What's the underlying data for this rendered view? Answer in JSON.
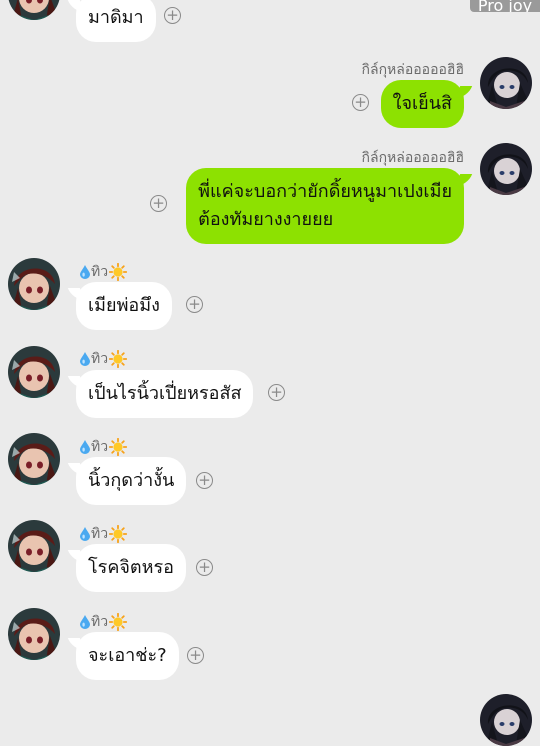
{
  "overlay": {
    "watermark": "Pro joy"
  },
  "plus_glyph": "+",
  "messages": [
    {
      "sender": "",
      "text": "มาดิมา",
      "side": "in"
    },
    {
      "sender": "กิล์กุหล่อออออฮิฮิ",
      "text": "ใจเย็นสิ",
      "side": "out"
    },
    {
      "sender": "กิล์กุหล่อออออฮิฮิ",
      "text_line1": "พี่แค่จะบอกว่ายักดิ้ยหนูมาเปงเมีย",
      "text_line2": "ต้องทัมยางงายยย",
      "side": "out"
    },
    {
      "sender": "ทิว",
      "text": "เมียพ่อมึง",
      "side": "in"
    },
    {
      "sender": "ทิว",
      "text": "เป็นไรนิ้วเปี่ยหรอสัส",
      "side": "in"
    },
    {
      "sender": "ทิว",
      "text": "นิ้วกุดว่างั้น",
      "side": "in"
    },
    {
      "sender": "ทิว",
      "text": "โรคจิตหรอ",
      "side": "in"
    },
    {
      "sender": "ทิว",
      "text": "จะเอาช่ะ?",
      "side": "in"
    }
  ],
  "colors": {
    "background": "#ebebeb",
    "incoming_bubble": "#ffffff",
    "outgoing_bubble": "#8de101"
  },
  "icons": {
    "sender_prefix": "droplet-icon",
    "sender_suffix": "sun-icon",
    "reaction": "add-reaction-icon"
  }
}
